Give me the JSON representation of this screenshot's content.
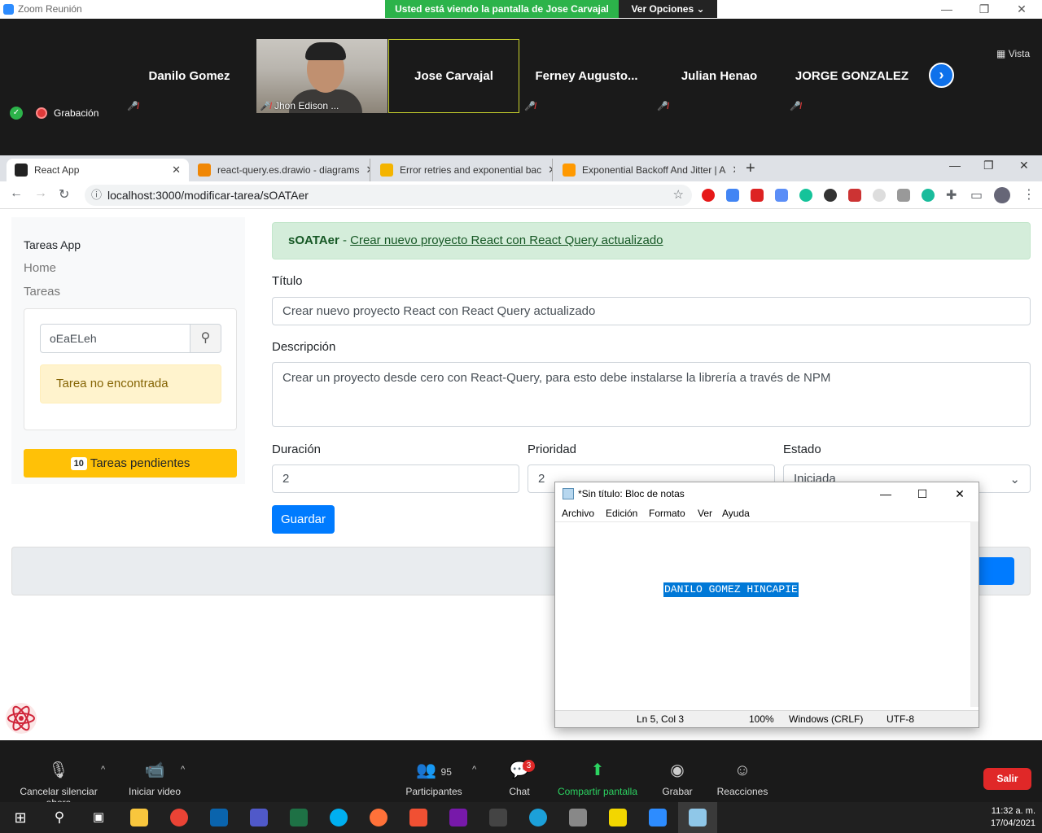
{
  "zoom": {
    "window_title": "Zoom Reunión",
    "viewing_banner": "Usted está viendo la pantalla de Jose Carvajal",
    "view_options": "Ver Opciones",
    "view_toggle": "Vista",
    "recording_label": "Grabación",
    "participants": [
      {
        "name": "Danilo Gomez"
      },
      {
        "name": "Jhon Edison ..."
      },
      {
        "name": "Jose Carvajal"
      },
      {
        "name": "Ferney  Augusto..."
      },
      {
        "name": "Julian Henao"
      },
      {
        "name": "JORGE GONZALEZ"
      }
    ],
    "controls": {
      "mute": "Cancelar silenciar ahora",
      "video": "Iniciar video",
      "participants": "Participantes",
      "participants_count": "95",
      "chat": "Chat",
      "chat_badge": "3",
      "share": "Compartir pantalla",
      "record": "Grabar",
      "reactions": "Reacciones",
      "exit": "Salir"
    }
  },
  "browser": {
    "tabs": [
      {
        "label": "React App"
      },
      {
        "label": "react-query.es.drawio - diagrams"
      },
      {
        "label": "Error retries and exponential bac"
      },
      {
        "label": "Exponential Backoff And Jitter | A"
      }
    ],
    "url": "localhost:3000/modificar-tarea/sOATAer"
  },
  "app": {
    "brand": "Tareas App",
    "nav": [
      "Home",
      "Tareas"
    ],
    "search_value": "oEaELeh",
    "not_found": "Tarea no encontrada",
    "pending_count": "10",
    "pending_label": "Tareas pendientes",
    "alert_id": "sOATAer",
    "alert_sep": " - ",
    "alert_link": "Crear nuevo proyecto React con React Query actualizado",
    "form": {
      "title_label": "Título",
      "title_value": "Crear nuevo proyecto React con React Query actualizado",
      "description_label": "Descripción",
      "description_value": "Crear un proyecto desde cero con React-Query, para esto debe instalarse la librería a través de NPM",
      "duration_label": "Duración",
      "duration_value": "2",
      "priority_label": "Prioridad",
      "priority_value": "2",
      "status_label": "Estado",
      "status_value": "Iniciada",
      "save": "Guardar"
    }
  },
  "notepad": {
    "title": "*Sin título: Bloc de notas",
    "menu": [
      "Archivo",
      "Edición",
      "Formato",
      "Ver",
      "Ayuda"
    ],
    "selected_text": "DANILO GOMEZ HINCAPIE",
    "status": {
      "position": "Ln 5, Col 3",
      "zoom": "100%",
      "line_ending": "Windows (CRLF)",
      "encoding": "UTF-8"
    }
  },
  "taskbar": {
    "time": "11:32 a. m.",
    "date": "17/04/2021"
  }
}
